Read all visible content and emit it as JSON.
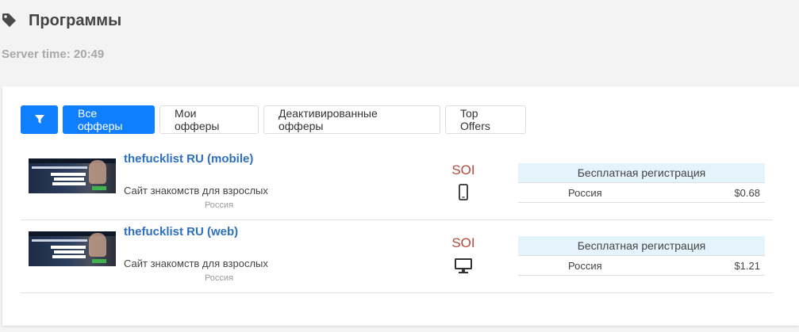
{
  "page": {
    "title": "Программы",
    "server_time": "Server time: 20:49"
  },
  "toolbar": {
    "filter_icon": "filter-icon",
    "tabs": [
      {
        "label": "Все офферы",
        "active": true
      },
      {
        "label": "Мои офферы",
        "active": false
      },
      {
        "label": "Деактивированные офферы",
        "active": false
      },
      {
        "label": "Top Offers",
        "active": false
      }
    ]
  },
  "offers": [
    {
      "name": "thefucklist RU (mobile)",
      "description": "Сайт знакомств для взрослых",
      "country": "Россия",
      "conversion_type": "SOI",
      "device": "mobile-icon",
      "payout_header": "Бесплатная регистрация",
      "payout_country": "Россия",
      "payout_amount": "$0.68"
    },
    {
      "name": "thefucklist RU (web)",
      "description": "Сайт знакомств для взрослых",
      "country": "Россия",
      "conversion_type": "SOI",
      "device": "desktop-icon",
      "payout_header": "Бесплатная регистрация",
      "payout_country": "Россия",
      "payout_amount": "$1.21"
    }
  ],
  "colors": {
    "accent": "#0f7fff",
    "link": "#2d6fc1",
    "soi": "#b5493c",
    "payout_header_bg": "#e4f3fc"
  }
}
